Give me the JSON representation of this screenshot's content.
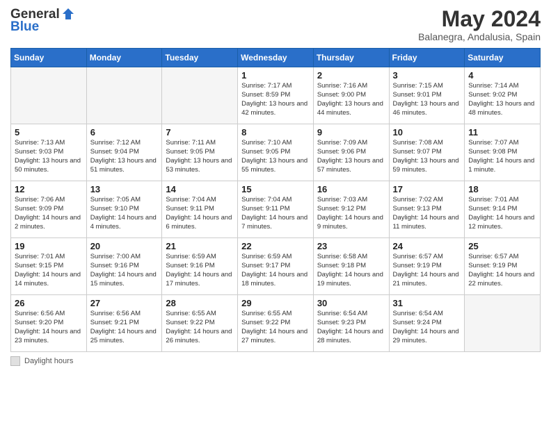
{
  "header": {
    "logo_line1": "General",
    "logo_line2": "Blue",
    "month_title": "May 2024",
    "location": "Balanegra, Andalusia, Spain"
  },
  "days_of_week": [
    "Sunday",
    "Monday",
    "Tuesday",
    "Wednesday",
    "Thursday",
    "Friday",
    "Saturday"
  ],
  "weeks": [
    [
      {
        "day": "",
        "info": ""
      },
      {
        "day": "",
        "info": ""
      },
      {
        "day": "",
        "info": ""
      },
      {
        "day": "1",
        "info": "Sunrise: 7:17 AM\nSunset: 8:59 PM\nDaylight: 13 hours and 42 minutes."
      },
      {
        "day": "2",
        "info": "Sunrise: 7:16 AM\nSunset: 9:00 PM\nDaylight: 13 hours and 44 minutes."
      },
      {
        "day": "3",
        "info": "Sunrise: 7:15 AM\nSunset: 9:01 PM\nDaylight: 13 hours and 46 minutes."
      },
      {
        "day": "4",
        "info": "Sunrise: 7:14 AM\nSunset: 9:02 PM\nDaylight: 13 hours and 48 minutes."
      }
    ],
    [
      {
        "day": "5",
        "info": "Sunrise: 7:13 AM\nSunset: 9:03 PM\nDaylight: 13 hours and 50 minutes."
      },
      {
        "day": "6",
        "info": "Sunrise: 7:12 AM\nSunset: 9:04 PM\nDaylight: 13 hours and 51 minutes."
      },
      {
        "day": "7",
        "info": "Sunrise: 7:11 AM\nSunset: 9:05 PM\nDaylight: 13 hours and 53 minutes."
      },
      {
        "day": "8",
        "info": "Sunrise: 7:10 AM\nSunset: 9:05 PM\nDaylight: 13 hours and 55 minutes."
      },
      {
        "day": "9",
        "info": "Sunrise: 7:09 AM\nSunset: 9:06 PM\nDaylight: 13 hours and 57 minutes."
      },
      {
        "day": "10",
        "info": "Sunrise: 7:08 AM\nSunset: 9:07 PM\nDaylight: 13 hours and 59 minutes."
      },
      {
        "day": "11",
        "info": "Sunrise: 7:07 AM\nSunset: 9:08 PM\nDaylight: 14 hours and 1 minute."
      }
    ],
    [
      {
        "day": "12",
        "info": "Sunrise: 7:06 AM\nSunset: 9:09 PM\nDaylight: 14 hours and 2 minutes."
      },
      {
        "day": "13",
        "info": "Sunrise: 7:05 AM\nSunset: 9:10 PM\nDaylight: 14 hours and 4 minutes."
      },
      {
        "day": "14",
        "info": "Sunrise: 7:04 AM\nSunset: 9:11 PM\nDaylight: 14 hours and 6 minutes."
      },
      {
        "day": "15",
        "info": "Sunrise: 7:04 AM\nSunset: 9:11 PM\nDaylight: 14 hours and 7 minutes."
      },
      {
        "day": "16",
        "info": "Sunrise: 7:03 AM\nSunset: 9:12 PM\nDaylight: 14 hours and 9 minutes."
      },
      {
        "day": "17",
        "info": "Sunrise: 7:02 AM\nSunset: 9:13 PM\nDaylight: 14 hours and 11 minutes."
      },
      {
        "day": "18",
        "info": "Sunrise: 7:01 AM\nSunset: 9:14 PM\nDaylight: 14 hours and 12 minutes."
      }
    ],
    [
      {
        "day": "19",
        "info": "Sunrise: 7:01 AM\nSunset: 9:15 PM\nDaylight: 14 hours and 14 minutes."
      },
      {
        "day": "20",
        "info": "Sunrise: 7:00 AM\nSunset: 9:16 PM\nDaylight: 14 hours and 15 minutes."
      },
      {
        "day": "21",
        "info": "Sunrise: 6:59 AM\nSunset: 9:16 PM\nDaylight: 14 hours and 17 minutes."
      },
      {
        "day": "22",
        "info": "Sunrise: 6:59 AM\nSunset: 9:17 PM\nDaylight: 14 hours and 18 minutes."
      },
      {
        "day": "23",
        "info": "Sunrise: 6:58 AM\nSunset: 9:18 PM\nDaylight: 14 hours and 19 minutes."
      },
      {
        "day": "24",
        "info": "Sunrise: 6:57 AM\nSunset: 9:19 PM\nDaylight: 14 hours and 21 minutes."
      },
      {
        "day": "25",
        "info": "Sunrise: 6:57 AM\nSunset: 9:19 PM\nDaylight: 14 hours and 22 minutes."
      }
    ],
    [
      {
        "day": "26",
        "info": "Sunrise: 6:56 AM\nSunset: 9:20 PM\nDaylight: 14 hours and 23 minutes."
      },
      {
        "day": "27",
        "info": "Sunrise: 6:56 AM\nSunset: 9:21 PM\nDaylight: 14 hours and 25 minutes."
      },
      {
        "day": "28",
        "info": "Sunrise: 6:55 AM\nSunset: 9:22 PM\nDaylight: 14 hours and 26 minutes."
      },
      {
        "day": "29",
        "info": "Sunrise: 6:55 AM\nSunset: 9:22 PM\nDaylight: 14 hours and 27 minutes."
      },
      {
        "day": "30",
        "info": "Sunrise: 6:54 AM\nSunset: 9:23 PM\nDaylight: 14 hours and 28 minutes."
      },
      {
        "day": "31",
        "info": "Sunrise: 6:54 AM\nSunset: 9:24 PM\nDaylight: 14 hours and 29 minutes."
      },
      {
        "day": "",
        "info": ""
      }
    ]
  ],
  "footer": {
    "label": "Daylight hours"
  }
}
